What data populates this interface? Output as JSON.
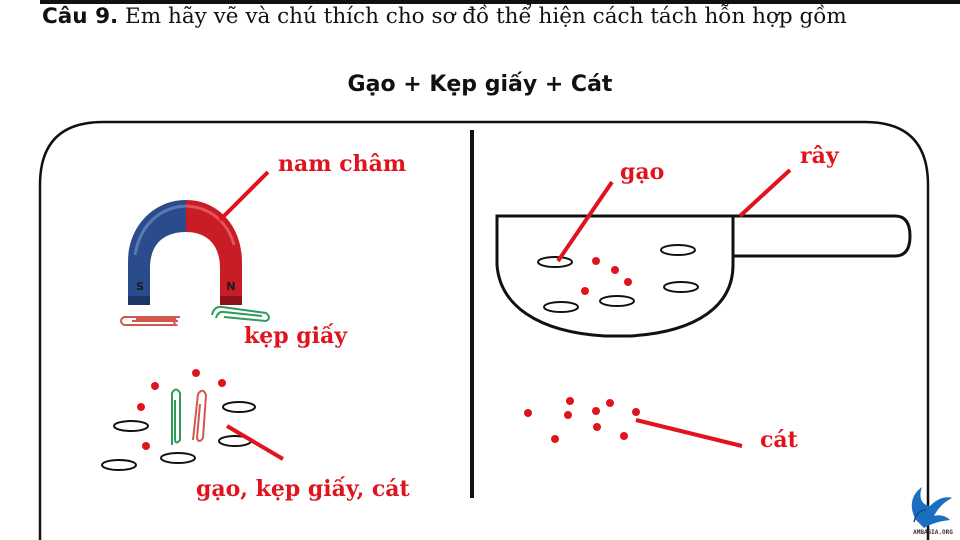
{
  "question": {
    "number": "Câu 9.",
    "text": " Em hãy vẽ và chú thích cho sơ đồ thể hiện cách tách hỗn hợp gồm"
  },
  "subtitle": "Gạo + Kẹp giấy + Cát",
  "labels": {
    "magnet": "nam châm",
    "clips": "kẹp giấy",
    "mixture": "gạo, kẹp giấy, cát",
    "rice": "gạo",
    "sieve": "rây",
    "sand": "cát"
  },
  "magnet_poles": {
    "south": "S",
    "north": "N"
  },
  "logo": {
    "icon": "eagle-logo-icon",
    "text": "AMBASIA.ORG"
  },
  "colors": {
    "label_red": "#e0141e",
    "magnet_blue": "#2a4c8c",
    "magnet_red": "#c81d25",
    "clip_green": "#2f9a5a",
    "clip_red": "#d0584f",
    "outline": "#111111",
    "logo_blue": "#1a6fc0"
  }
}
